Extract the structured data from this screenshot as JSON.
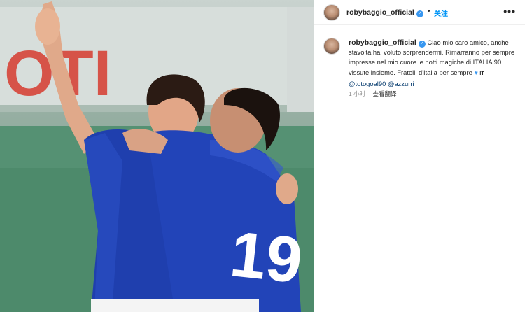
{
  "post": {
    "username": "robybaggio_official",
    "follow_label": "关注",
    "more_label": "•••"
  },
  "caption": {
    "username": "robybaggio_official",
    "text": "Ciao mio caro amico, anche stavolta hai voluto sorprendermi. Rimarranno per sempre impresse nel mio cuore le notti magiche di ITALIA 90 vissute insieme. Fratelli d'Italia per sempre",
    "flag": "IT",
    "mention_1": "@totogoal90",
    "mention_2": "@azzurri",
    "time": "1 小时",
    "translate_label": "查看翻译"
  },
  "photo": {
    "jersey_number": "19",
    "banner_text": "OTI"
  },
  "colors": {
    "accent": "#0095f6",
    "verified": "#3897f0",
    "jersey": "#1f3fae",
    "pitch": "#4d8a6b"
  }
}
